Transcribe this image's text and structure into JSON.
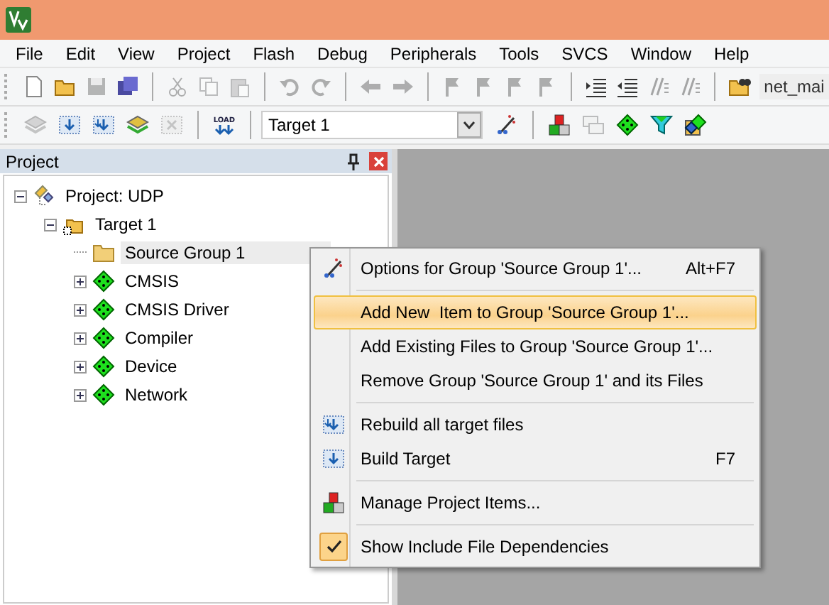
{
  "menu_bar": [
    "File",
    "Edit",
    "View",
    "Project",
    "Flash",
    "Debug",
    "Peripherals",
    "Tools",
    "SVCS",
    "Window",
    "Help"
  ],
  "toolbar_1": [
    {
      "kind": "new",
      "disabled": false
    },
    {
      "kind": "open",
      "disabled": false
    },
    {
      "kind": "save",
      "disabled": true
    },
    {
      "kind": "saveall",
      "disabled": false
    },
    {
      "kind": "separator"
    },
    {
      "kind": "cut",
      "disabled": true
    },
    {
      "kind": "copy",
      "disabled": true
    },
    {
      "kind": "paste",
      "disabled": true
    },
    {
      "kind": "separator"
    },
    {
      "kind": "undo",
      "disabled": true
    },
    {
      "kind": "redo",
      "disabled": true
    },
    {
      "kind": "separator"
    },
    {
      "kind": "back",
      "disabled": true
    },
    {
      "kind": "forward",
      "disabled": true
    },
    {
      "kind": "separator"
    },
    {
      "kind": "flag",
      "disabled": true
    },
    {
      "kind": "flag",
      "disabled": true
    },
    {
      "kind": "flag",
      "disabled": true
    },
    {
      "kind": "flag",
      "disabled": true
    },
    {
      "kind": "separator"
    },
    {
      "kind": "indent",
      "disabled": false
    },
    {
      "kind": "outdent",
      "disabled": false
    },
    {
      "kind": "comment",
      "disabled": true
    },
    {
      "kind": "uncomment",
      "disabled": true
    },
    {
      "kind": "separator"
    },
    {
      "kind": "find",
      "disabled": false
    },
    {
      "kind": "field",
      "value": "net_mai"
    }
  ],
  "toolbar_2": [
    {
      "kind": "translate",
      "disabled": true
    },
    {
      "kind": "build",
      "disabled": false
    },
    {
      "kind": "rebuild",
      "disabled": false
    },
    {
      "kind": "layers",
      "disabled": false
    },
    {
      "kind": "stop",
      "disabled": true
    },
    {
      "kind": "separator"
    },
    {
      "kind": "load",
      "label": "LOAD",
      "disabled": false
    },
    {
      "kind": "separator"
    },
    {
      "kind": "select",
      "value": "Target 1"
    },
    {
      "kind": "wand",
      "disabled": false
    },
    {
      "kind": "separator"
    },
    {
      "kind": "blocks",
      "disabled": false
    },
    {
      "kind": "windows",
      "disabled": true
    },
    {
      "kind": "diamond",
      "disabled": false
    },
    {
      "kind": "funnel",
      "disabled": false
    },
    {
      "kind": "multi",
      "disabled": false
    }
  ],
  "project_panel": {
    "title": "Project",
    "tree": [
      {
        "label": "Project: UDP",
        "kind": "project",
        "expanded": true,
        "selected": false,
        "children": [
          {
            "label": "Target 1",
            "kind": "target",
            "expanded": true,
            "selected": false,
            "children": [
              {
                "label": "Source Group 1",
                "kind": "folder",
                "selected": true
              },
              {
                "label": "CMSIS",
                "kind": "component",
                "expanded": false,
                "selected": false
              },
              {
                "label": "CMSIS Driver",
                "kind": "component",
                "expanded": false,
                "selected": false
              },
              {
                "label": "Compiler",
                "kind": "component",
                "expanded": false,
                "selected": false
              },
              {
                "label": "Device",
                "kind": "component",
                "expanded": false,
                "selected": false
              },
              {
                "label": "Network",
                "kind": "component",
                "expanded": false,
                "selected": false
              }
            ]
          }
        ]
      }
    ]
  },
  "context_menu": [
    {
      "kind": "wand",
      "label": "Options for Group 'Source Group 1'...",
      "shortcut": "Alt+F7",
      "selected": false,
      "checked": false
    },
    {
      "kind": "separator"
    },
    {
      "kind": "plain",
      "label": "Add New  Item to Group 'Source Group 1'...",
      "selected": true,
      "checked": false
    },
    {
      "kind": "plain",
      "label": "Add Existing Files to Group 'Source Group 1'...",
      "selected": false,
      "checked": false
    },
    {
      "kind": "plain",
      "label": "Remove Group 'Source Group 1' and its Files",
      "selected": false,
      "checked": false
    },
    {
      "kind": "separator"
    },
    {
      "kind": "rebuild",
      "label": "Rebuild all target files",
      "selected": false,
      "checked": false
    },
    {
      "kind": "build",
      "label": "Build Target",
      "shortcut": "F7",
      "selected": false,
      "checked": false
    },
    {
      "kind": "separator"
    },
    {
      "kind": "blocks",
      "label": "Manage Project Items...",
      "selected": false,
      "checked": false
    },
    {
      "kind": "separator"
    },
    {
      "kind": "plain",
      "label": "Show Include File Dependencies",
      "selected": false,
      "checked": true
    }
  ]
}
